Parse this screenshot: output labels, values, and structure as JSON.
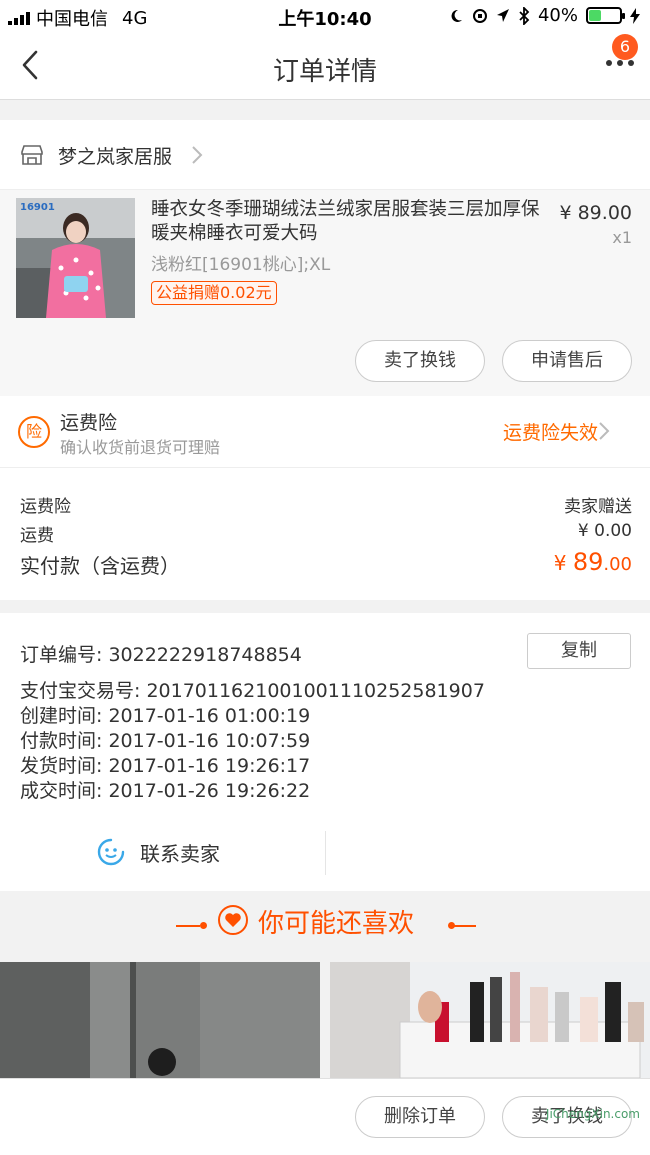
{
  "status_bar": {
    "carrier": "中国电信",
    "network": "4G",
    "time": "上午10:40",
    "battery": "40%",
    "battery_level": 0.4
  },
  "nav": {
    "title": "订单详情",
    "badge_count": "6"
  },
  "store": {
    "name": "梦之岚家居服"
  },
  "product": {
    "thumb_label": "16901",
    "title": "睡衣女冬季珊瑚绒法兰绒家居服套装三层加厚保暖夹棉睡衣可爱大码",
    "sku": "浅粉红[16901桃心];XL",
    "tag": "公益捐赠0.02元",
    "price": "¥ 89.00",
    "quantity": "x1",
    "buttons": {
      "sell": "卖了换钱",
      "after_sale": "申请售后"
    }
  },
  "insurance": {
    "icon_text": "险",
    "title": "运费险",
    "subtitle": "确认收货前退货可理赔",
    "status": "运费险失效"
  },
  "summary": {
    "insurance_label": "运费险",
    "insurance_value": "卖家赠送",
    "shipping_label": "运费",
    "shipping_value": "¥ 0.00",
    "paid_label": "实付款（含运费）",
    "paid_currency": "¥ ",
    "paid_int": "89",
    "paid_dec": ".00"
  },
  "order_info": {
    "order_no": "订单编号:  3022222918748854",
    "copy": "复制",
    "alipay_no": "支付宝交易号:  2017011621001001110252581907",
    "created": "创建时间:  2017-01-16 01:00:19",
    "paid": "付款时间:  2017-01-16 10:07:59",
    "shipped": "发货时间:  2017-01-16 19:26:17",
    "completed": "成交时间:  2017-01-26 19:26:22",
    "contact": "联系卖家"
  },
  "recommend": {
    "title": "你可能还喜欢"
  },
  "bottom": {
    "delete": "删除订单",
    "sell": "卖了换钱",
    "watermark": "JiChengXin.com"
  },
  "colors": {
    "accent": "#ff5000",
    "insurance": "#ff6a00",
    "contact_icon": "#3aa8e8"
  }
}
